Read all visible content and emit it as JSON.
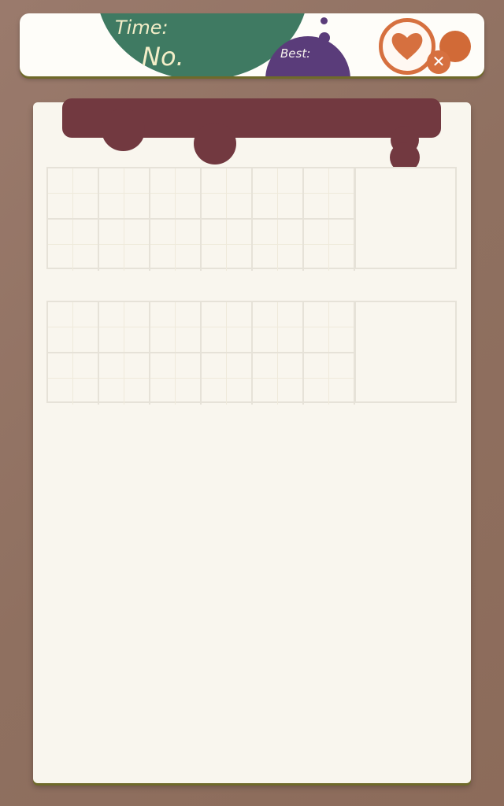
{
  "header": {
    "time_label": "Time:",
    "no_label": "No.",
    "best_label": "Best:"
  },
  "icons": {
    "heart": "heart-icon",
    "close": "close-icon",
    "close_glyph": "✕"
  },
  "colors": {
    "background": "#917363",
    "green": "#3f7a62",
    "purple": "#5a3c7a",
    "orange": "#d6703f",
    "maroon": "#723940",
    "paper": "#f9f6ee"
  },
  "grids": [
    {
      "rows": 2,
      "cols": 6
    },
    {
      "rows": 2,
      "cols": 6
    }
  ]
}
